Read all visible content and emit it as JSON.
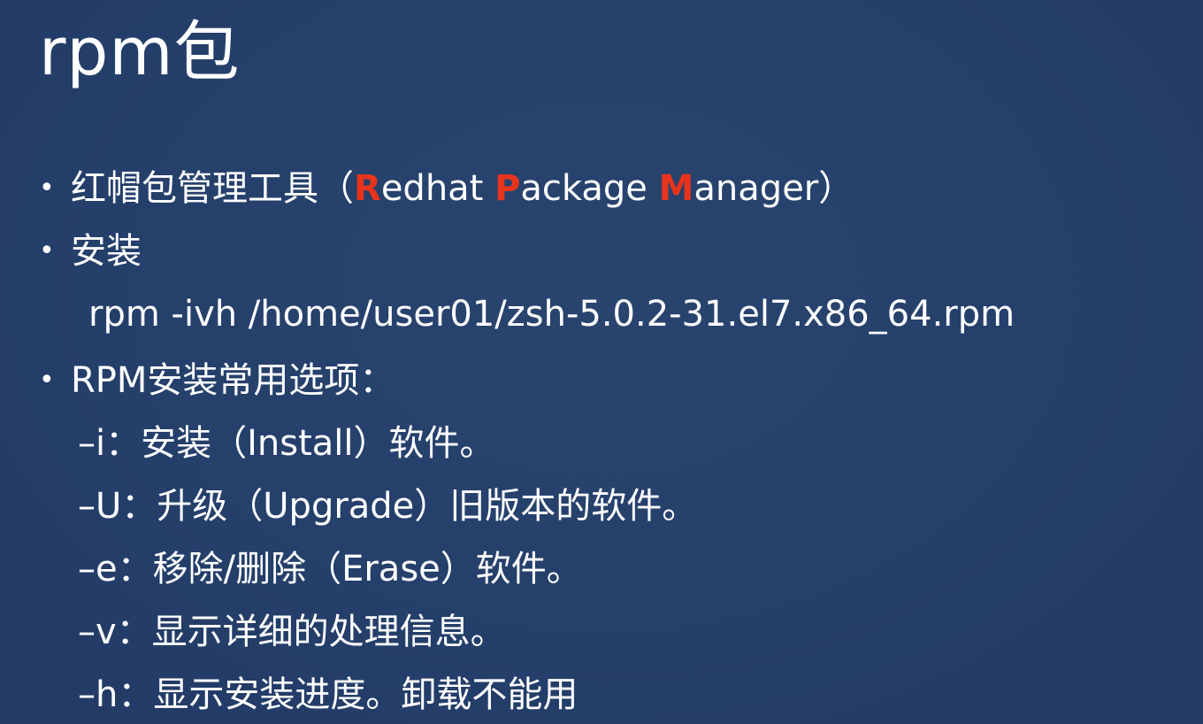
{
  "slide": {
    "title": "rpm包",
    "bullets": [
      {
        "prefix": "红帽包管理工具（",
        "words": [
          {
            "initial": "R",
            "rest": "edhat "
          },
          {
            "initial": "P",
            "rest": "ackage "
          },
          {
            "initial": "M",
            "rest": "anager"
          }
        ],
        "suffix": "）"
      },
      {
        "text": "安装"
      },
      {
        "text": "RPM安装常用选项："
      }
    ],
    "install_command": "rpm -ivh /home/user01/zsh-5.0.2-31.el7.x86_64.rpm",
    "options": [
      "–i：安装（Install）软件。",
      "–U：升级（Upgrade）旧版本的软件。",
      "–e：移除/删除（Erase）软件。",
      "–v：显示详细的处理信息。",
      "–h：显示安装进度。卸载不能用"
    ],
    "bullet_symbol": "•",
    "colors": {
      "background": "#26406d",
      "text": "#ffffff",
      "highlight": "#e8341d"
    }
  }
}
